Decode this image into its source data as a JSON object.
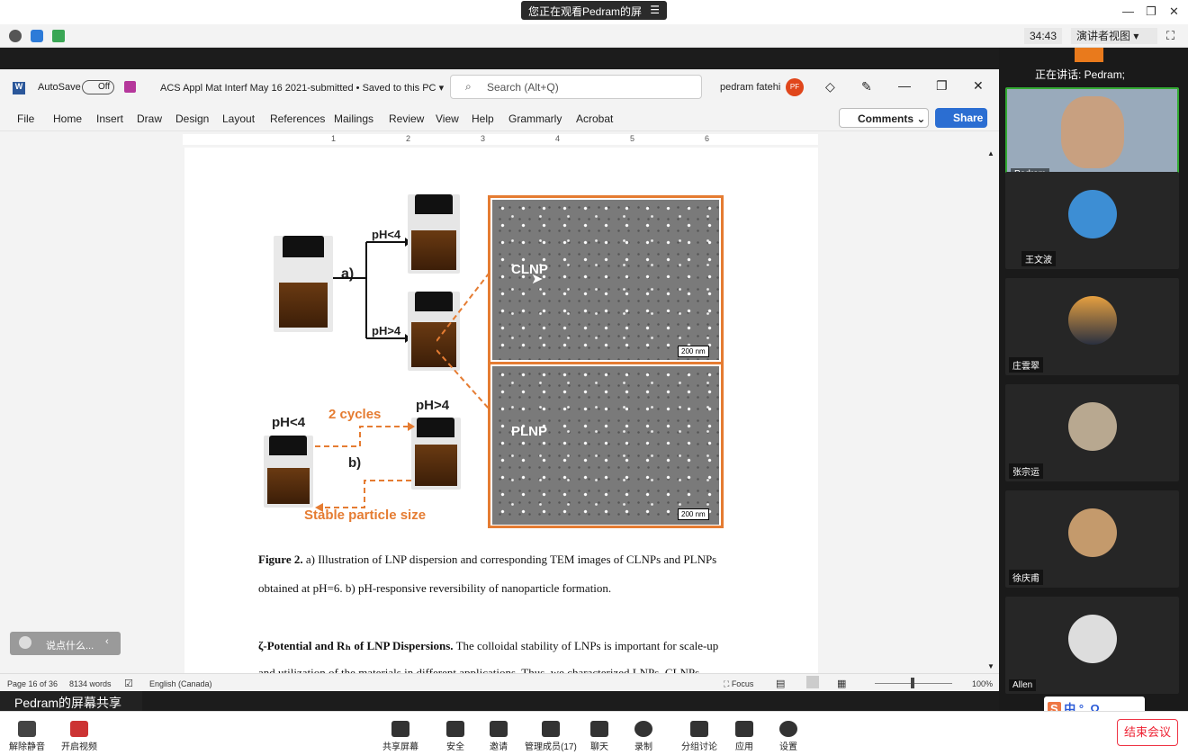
{
  "zoom_top": {
    "sharing_banner": "您正在观看Pedram的屏幕",
    "timer": "34:43",
    "view_mode": "演讲者视图"
  },
  "word": {
    "autosave_label": "AutoSave",
    "autosave_state": "Off",
    "doc_title": "ACS Appl Mat Interf May 16 2021-submitted • Saved to this PC",
    "search_placeholder": "Search (Alt+Q)",
    "user_name": "pedram fatehi",
    "user_initials": "PF",
    "menu": [
      "File",
      "Home",
      "Insert",
      "Draw",
      "Design",
      "Layout",
      "References",
      "Mailings",
      "Review",
      "View",
      "Help",
      "Grammarly",
      "Acrobat"
    ],
    "comments_label": "Comments",
    "share_label": "Share",
    "ruler_marks": [
      "1",
      "2",
      "3",
      "4",
      "5",
      "6"
    ],
    "figure": {
      "label_a": "a)",
      "label_b": "b)",
      "ph_lt4": "pH<4",
      "ph_gt4": "pH>4",
      "ph_lt4_b": "pH<4",
      "ph_gt4_b": "pH>4",
      "cycles": "2 cycles",
      "stable": "Stable particle size",
      "clnp": "CLNP",
      "plnp": "PLNP",
      "scale1": "200 nm",
      "scale2": "200 nm"
    },
    "caption_bold": "Figure 2.",
    "caption_line1": "a) Illustration of LNP dispersion and corresponding TEM images of CLNPs and PLNPs",
    "caption_line2": "obtained at pH=6. b) pH-responsive reversibility of nanoparticle formation.",
    "para_bold": "ζ-Potential and Rₕ of LNP Dispersions.",
    "para_text": "The colloidal stability of LNPs is important for scale-up",
    "para_cut": "and utilization of the materials in different applications. Thus, we characterized LNPs, CLNPs",
    "status": {
      "page": "Page 16 of 36",
      "words": "8134 words",
      "language": "English (Canada)",
      "focus": "Focus",
      "zoom": "100%"
    }
  },
  "mic_hint": "说点什么...",
  "share_label": "Pedram的屏幕共享",
  "toolbar": {
    "unmute": "解除静音",
    "video": "开启视频",
    "share": "共享屏幕",
    "security": "安全",
    "invite": "邀请",
    "participants": "管理成员(17)",
    "chat": "聊天",
    "record": "录制",
    "breakout": "分组讨论",
    "apps": "应用",
    "settings": "设置",
    "end": "结束会议"
  },
  "panel": {
    "speaking": "正在讲话: Pedram;",
    "participants": [
      "Pedram",
      "王文波",
      "庄雲翠",
      "张宗运",
      "徐庆甫",
      "Allen"
    ]
  },
  "ime": "中 °, Ω"
}
